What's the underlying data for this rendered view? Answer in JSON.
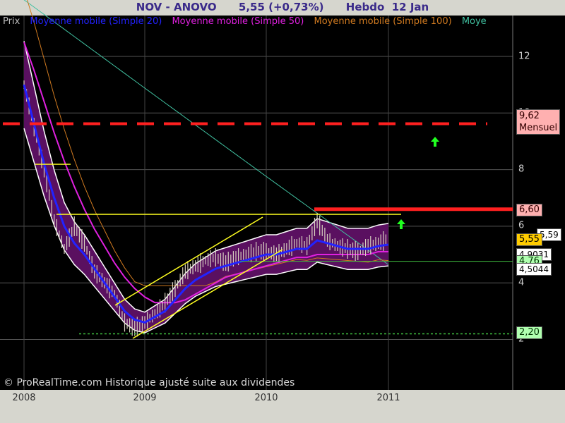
{
  "header": {
    "title": "NOV - ANOVO      5,55 (+0,73%)      Hebdo  12 Jan"
  },
  "legend": [
    {
      "label": "Prix",
      "color": "#bdbdbd"
    },
    {
      "label": "Moyenne mobile (Simple 20)",
      "color": "#2222ff"
    },
    {
      "label": "Moyenne mobile (Simple 50)",
      "color": "#e020e0"
    },
    {
      "label": "Moyenne mobile (Simple 100)",
      "color": "#d07a20"
    },
    {
      "label": "Moye",
      "color": "#40c0a0"
    }
  ],
  "footer": {
    "watermark": "© ProRealTime.com Historique ajusté suite aux dividendes"
  },
  "colors": {
    "background": "#000000",
    "price": "#d8d0c0",
    "band": "#5a1060",
    "band_edge": "#ffffff",
    "ma20": "#2222ff",
    "ma50": "#e020e0",
    "ma100": "#d07a20",
    "ma200": "#40c0a0",
    "resistance": "#ff2020",
    "trendline": "#ffff20",
    "support": "#40c040",
    "arrow": "#20ff20"
  },
  "chart_data": {
    "type": "line",
    "x_ticks": [
      "2008",
      "2009",
      "2010",
      "2011"
    ],
    "y_ticks": [
      "12",
      "10",
      "8",
      "6",
      "4",
      "2"
    ],
    "ylim": [
      0.5,
      13.8
    ],
    "grid": true,
    "price_points": [
      {
        "date": "2008-01",
        "value": 11.0
      },
      {
        "date": "2008-02",
        "value": 9.5
      },
      {
        "date": "2008-03",
        "value": 8.0
      },
      {
        "date": "2008-04",
        "value": 6.2
      },
      {
        "date": "2008-05",
        "value": 5.2
      },
      {
        "date": "2008-06",
        "value": 6.0
      },
      {
        "date": "2008-07",
        "value": 5.4
      },
      {
        "date": "2008-08",
        "value": 4.4
      },
      {
        "date": "2008-09",
        "value": 4.0
      },
      {
        "date": "2008-10",
        "value": 3.6
      },
      {
        "date": "2008-11",
        "value": 2.6
      },
      {
        "date": "2008-12",
        "value": 2.4
      },
      {
        "date": "2009-01",
        "value": 2.6
      },
      {
        "date": "2009-02",
        "value": 2.9
      },
      {
        "date": "2009-03",
        "value": 3.3
      },
      {
        "date": "2009-04",
        "value": 3.8
      },
      {
        "date": "2009-05",
        "value": 4.4
      },
      {
        "date": "2009-06",
        "value": 4.6
      },
      {
        "date": "2009-07",
        "value": 4.8
      },
      {
        "date": "2009-08",
        "value": 4.9
      },
      {
        "date": "2009-09",
        "value": 4.7
      },
      {
        "date": "2009-10",
        "value": 4.9
      },
      {
        "date": "2009-11",
        "value": 5.0
      },
      {
        "date": "2009-12",
        "value": 5.1
      },
      {
        "date": "2010-01",
        "value": 5.1
      },
      {
        "date": "2010-02",
        "value": 5.0
      },
      {
        "date": "2010-03",
        "value": 5.2
      },
      {
        "date": "2010-04",
        "value": 5.4
      },
      {
        "date": "2010-05",
        "value": 5.3
      },
      {
        "date": "2010-06",
        "value": 6.2
      },
      {
        "date": "2010-07",
        "value": 5.5
      },
      {
        "date": "2010-08",
        "value": 5.3
      },
      {
        "date": "2010-09",
        "value": 5.2
      },
      {
        "date": "2010-10",
        "value": 5.1
      },
      {
        "date": "2010-11",
        "value": 5.3
      },
      {
        "date": "2010-12",
        "value": 5.4
      },
      {
        "date": "2011-01",
        "value": 5.55
      }
    ],
    "series": [
      {
        "name": "Moyenne mobile (Simple 20)",
        "values": [
          11.0,
          9.6,
          8.2,
          7.0,
          6.0,
          5.4,
          5.0,
          4.5,
          4.0,
          3.5,
          3.0,
          2.7,
          2.6,
          2.8,
          3.0,
          3.4,
          3.8,
          4.1,
          4.3,
          4.5,
          4.6,
          4.7,
          4.8,
          4.9,
          5.0,
          5.0,
          5.1,
          5.2,
          5.2,
          5.5,
          5.4,
          5.3,
          5.2,
          5.2,
          5.2,
          5.3,
          5.35
        ]
      },
      {
        "name": "Moyenne mobile (Simple 50)",
        "values": [
          12.5,
          11.5,
          10.4,
          9.3,
          8.3,
          7.4,
          6.6,
          5.9,
          5.3,
          4.7,
          4.2,
          3.8,
          3.5,
          3.3,
          3.3,
          3.3,
          3.4,
          3.6,
          3.8,
          4.0,
          4.2,
          4.3,
          4.4,
          4.5,
          4.6,
          4.7,
          4.8,
          4.9,
          4.9,
          5.0,
          5.0,
          5.0,
          5.0,
          5.0,
          5.0,
          5.1,
          5.1
        ]
      }
    ],
    "annotations": [
      {
        "label": "9,62",
        "sublabel": "Mensuel",
        "value": 9.62,
        "style": "dashed",
        "color": "#ff2020"
      },
      {
        "label": "6,60",
        "value": 6.6,
        "style": "solid",
        "color": "#ff2020"
      },
      {
        "label": "5,55",
        "value": 5.55,
        "style": "tag",
        "color": "#ffcc00"
      },
      {
        "label": "4,76",
        "value": 4.76,
        "style": "solid",
        "color": "#40c040"
      },
      {
        "label": "2,20",
        "value": 2.2,
        "style": "dotted",
        "color": "#40c040"
      }
    ],
    "side_labels": [
      "5,59",
      "4,9031",
      "4,5044"
    ]
  }
}
